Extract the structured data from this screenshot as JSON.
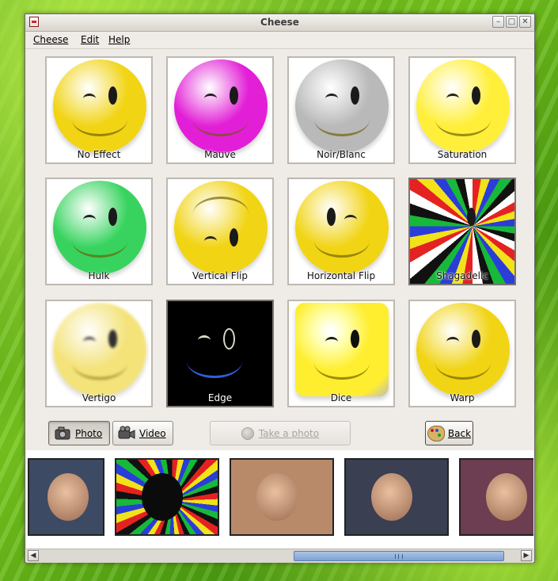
{
  "window": {
    "title": "Cheese",
    "controls": {
      "minimize_icon": "minimize-icon",
      "maximize_icon": "maximize-icon",
      "close_icon": "close-icon"
    }
  },
  "menubar": {
    "items": [
      "Cheese",
      "Edit",
      "Help"
    ]
  },
  "effects": [
    {
      "label": "No Effect",
      "face_color": "#f1d414",
      "selected": false
    },
    {
      "label": "Mauve",
      "face_color": "#e21fd6",
      "selected": false
    },
    {
      "label": "Noir/Blanc",
      "face_color": "#b9b9b9",
      "selected": false
    },
    {
      "label": "Saturation",
      "face_color": "#ffef3a",
      "selected": false
    },
    {
      "label": "Hulk",
      "face_color": "#37d35e",
      "selected": false
    },
    {
      "label": "Vertical Flip",
      "face_color": "#f1d414",
      "selected": false
    },
    {
      "label": "Horizontal Flip",
      "face_color": "#f1d414",
      "selected": false
    },
    {
      "label": "Shagadelic",
      "face_color": "#e03030",
      "selected": true
    },
    {
      "label": "Vertigo",
      "face_color": "#f3e06a",
      "selected": false
    },
    {
      "label": "Edge",
      "face_color": "#000000",
      "selected": true
    },
    {
      "label": "Dice",
      "face_color": "#f5e437",
      "selected": false
    },
    {
      "label": "Warp",
      "face_color": "#f1d414",
      "selected": false
    }
  ],
  "controls": {
    "photo": {
      "label": "Photo",
      "icon": "camera-icon",
      "active": true
    },
    "video": {
      "label": "Video",
      "icon": "video-camera-icon",
      "active": false
    },
    "take_photo": {
      "label": "Take a photo",
      "enabled": false
    },
    "back": {
      "label": "Back",
      "icon": "palette-icon"
    }
  },
  "gallery": {
    "thumbnails": [
      {
        "name": "thumbnail-photo-1",
        "bg": "#3d4a63"
      },
      {
        "name": "thumbnail-photo-2",
        "bg": "#20102a"
      },
      {
        "name": "thumbnail-photo-3",
        "bg": "#b88a6a"
      },
      {
        "name": "thumbnail-photo-4",
        "bg": "#3a3f52"
      },
      {
        "name": "thumbnail-photo-5",
        "bg": "#6d3d52"
      }
    ]
  },
  "colors": {
    "accent_scroll": "#7ea2d2",
    "window_bg": "#efebe7",
    "desktop_green": "#5fb019"
  }
}
